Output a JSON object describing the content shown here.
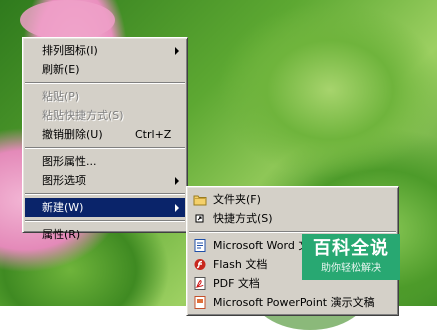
{
  "context_menu": {
    "items": [
      {
        "label": "排列图标(I)",
        "has_submenu": true
      },
      {
        "label": "刷新(E)"
      },
      {
        "label": "粘贴(P)",
        "disabled": true
      },
      {
        "label": "粘贴快捷方式(S)",
        "disabled": true
      },
      {
        "label": "撤销删除(U)",
        "shortcut": "Ctrl+Z"
      },
      {
        "label": "图形属性..."
      },
      {
        "label": "图形选项",
        "has_submenu": true
      },
      {
        "label": "新建(W)",
        "has_submenu": true,
        "highlighted": true
      },
      {
        "label": "属性(R)"
      }
    ]
  },
  "new_submenu": {
    "items": [
      {
        "label": "文件夹(F)",
        "icon": "folder-icon"
      },
      {
        "label": "快捷方式(S)",
        "icon": "shortcut-icon"
      },
      {
        "label": "Microsoft Word 文档",
        "icon": "word-document-icon"
      },
      {
        "label": "Flash 文档",
        "icon": "flash-document-icon"
      },
      {
        "label": "PDF 文档",
        "icon": "pdf-document-icon"
      },
      {
        "label": "Microsoft PowerPoint 演示文稿",
        "icon": "powerpoint-document-icon"
      }
    ]
  },
  "watermark": {
    "title": "百科全说",
    "subtitle": "助你轻松解决"
  },
  "colors": {
    "menu_bg": "#d4d0c8",
    "highlight": "#0a246a",
    "watermark_bg": "#28a872"
  }
}
